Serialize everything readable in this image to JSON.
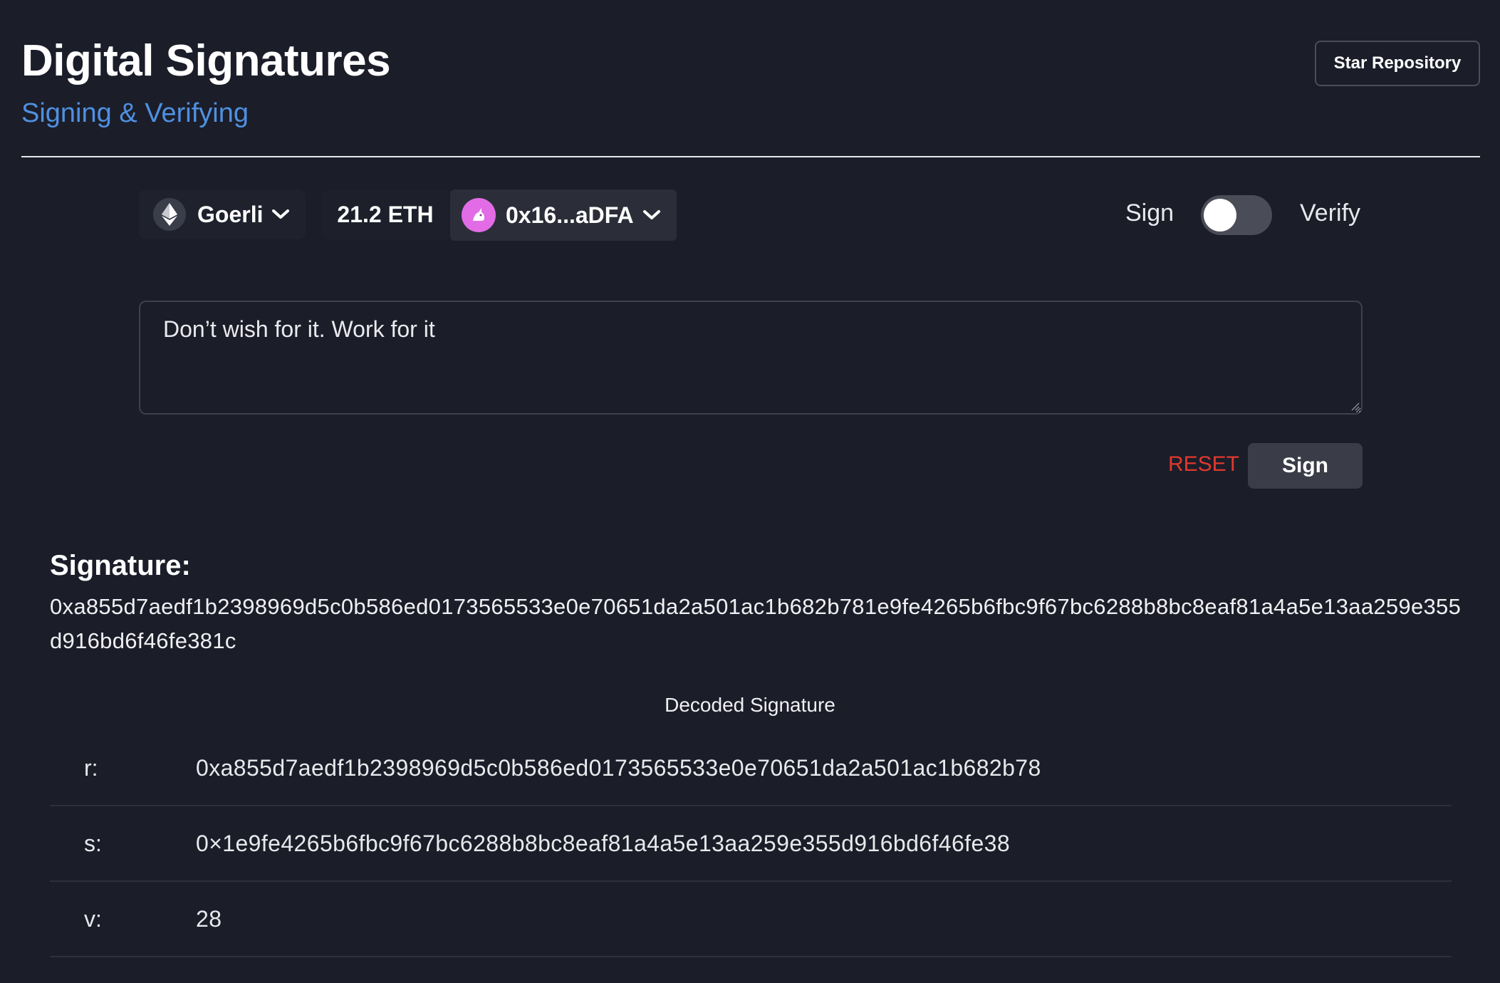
{
  "header": {
    "title": "Digital Signatures",
    "subtitle": "Signing & Verifying",
    "star_button": "Star Repository"
  },
  "wallet": {
    "network": "Goerli",
    "network_icon": "ethereum-icon",
    "balance": "21.2 ETH",
    "account": "0x16...aDFA",
    "account_avatar": "unicorn-avatar-icon"
  },
  "mode_toggle": {
    "left_label": "Sign",
    "right_label": "Verify",
    "state": "Sign"
  },
  "message": {
    "value": "Don’t wish for it. Work for it"
  },
  "actions": {
    "reset_label": "RESET",
    "sign_label": "Sign"
  },
  "signature": {
    "heading": "Signature:",
    "value": "0xa855d7aedf1b2398969d5c0b586ed0173565533e0e70651da2a501ac1b682b781e9fe4265b6fbc9f67bc6288b8bc8eaf81a4a5e13aa259e355d916bd6f46fe381c"
  },
  "decoded": {
    "heading": "Decoded Signature",
    "rows": [
      {
        "key": "r:",
        "value": "0xa855d7aedf1b2398969d5c0b586ed0173565533e0e70651da2a501ac1b682b78"
      },
      {
        "key": "s:",
        "value": "0×1e9fe4265b6fbc9f67bc6288b8bc8eaf81a4a5e13aa259e355d916bd6f46fe38"
      },
      {
        "key": "v:",
        "value": "28"
      }
    ]
  },
  "colors": {
    "background": "#1b1d29",
    "accent_blue": "#4f90e0",
    "reset_red": "#e0392d",
    "avatar_pink": "#e26ce6"
  }
}
